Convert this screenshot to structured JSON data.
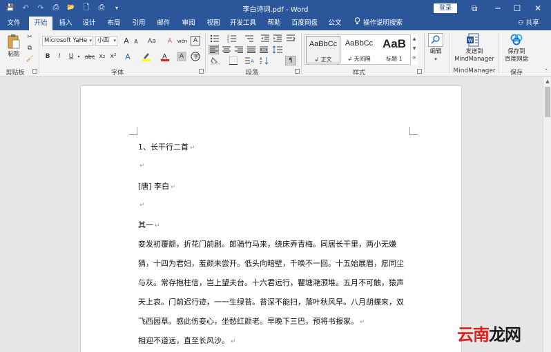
{
  "window": {
    "title": "李白诗词.pdf  -  Word",
    "login_label": "登录",
    "controls": {
      "restore": "⧉",
      "minimize": "─",
      "maximize": "☐",
      "close": "✕"
    }
  },
  "quick_access": {
    "save": "💾",
    "undo": "↶",
    "redo": "↷",
    "extra1": "⎙",
    "open": "📂",
    "new": "🗋",
    "print": "⎙",
    "customize": "▾"
  },
  "tabs": [
    {
      "label": "文件"
    },
    {
      "label": "开始"
    },
    {
      "label": "插入"
    },
    {
      "label": "设计"
    },
    {
      "label": "布局"
    },
    {
      "label": "引用"
    },
    {
      "label": "邮件"
    },
    {
      "label": "审阅"
    },
    {
      "label": "视图"
    },
    {
      "label": "开发工具"
    },
    {
      "label": "帮助"
    },
    {
      "label": "百度网盘"
    },
    {
      "label": "公文"
    },
    {
      "label": "操作说明搜索"
    }
  ],
  "share_label": "共享",
  "ribbon": {
    "clipboard": {
      "group_label": "剪贴板",
      "paste_label": "粘贴"
    },
    "font": {
      "group_label": "字体",
      "font_name": "Microsoft YaHe",
      "font_size": "小四",
      "bold": "B",
      "italic": "I",
      "underline": "U",
      "strike": "abc",
      "subscript": "x₂",
      "superscript": "x²",
      "grow": "A",
      "shrink": "A",
      "case": "Aa",
      "clear": "A",
      "phonetic": "wén",
      "border": "A"
    },
    "paragraph": {
      "group_label": "段落"
    },
    "styles": {
      "group_label": "样式",
      "items": [
        {
          "preview": "AaBbCc",
          "caption": "↲ 正文"
        },
        {
          "preview": "AaBbCc",
          "caption": "↲ 无间隔"
        },
        {
          "preview": "AaB",
          "caption": "标题 1"
        }
      ]
    },
    "editing": {
      "label": "编辑"
    },
    "mindmanager": {
      "button_label_1": "发送到",
      "button_label_2": "MindManager",
      "group_label": "MindManager"
    },
    "save_group": {
      "button_label_1": "保存到",
      "button_label_2": "百度网盘",
      "group_label": "保存"
    }
  },
  "document": {
    "lines": [
      {
        "text": "1、长干行二首",
        "mark": "↵"
      },
      {
        "text": "",
        "mark": "↵"
      },
      {
        "text": "[唐] 李白",
        "mark": "↵"
      },
      {
        "text": "",
        "mark": "↵"
      },
      {
        "text": "其一",
        "mark": "↵"
      },
      {
        "text": "妾发初覆额，折花门前剧。郎骑竹马来，绕床弄青梅。同居长干里，两小无嫌",
        "mark": ""
      },
      {
        "text": "猜，十四为君妇，羞颜未尝开。低头向暗壁，千唤不一回。十五始展眉，愿同尘",
        "mark": ""
      },
      {
        "text": "与灰。常存抱柱信，岂上望夫台。十六君远行，瞿塘滟滪堆。五月不可触，猿声",
        "mark": ""
      },
      {
        "text": "天上哀。门前迟行迹，一一生绿苔。苔深不能扫，落叶秋风早。八月胡蝶来，双",
        "mark": ""
      },
      {
        "text": "飞西园草。感此伤妾心，坐愁红颜老。早晚下三巴，预将书报家。",
        "mark": "↵"
      },
      {
        "text": "相迎不道远，直至长风沙。",
        "mark": "↵"
      }
    ]
  },
  "watermark": {
    "part1": "云南",
    "part2": "龙网"
  }
}
